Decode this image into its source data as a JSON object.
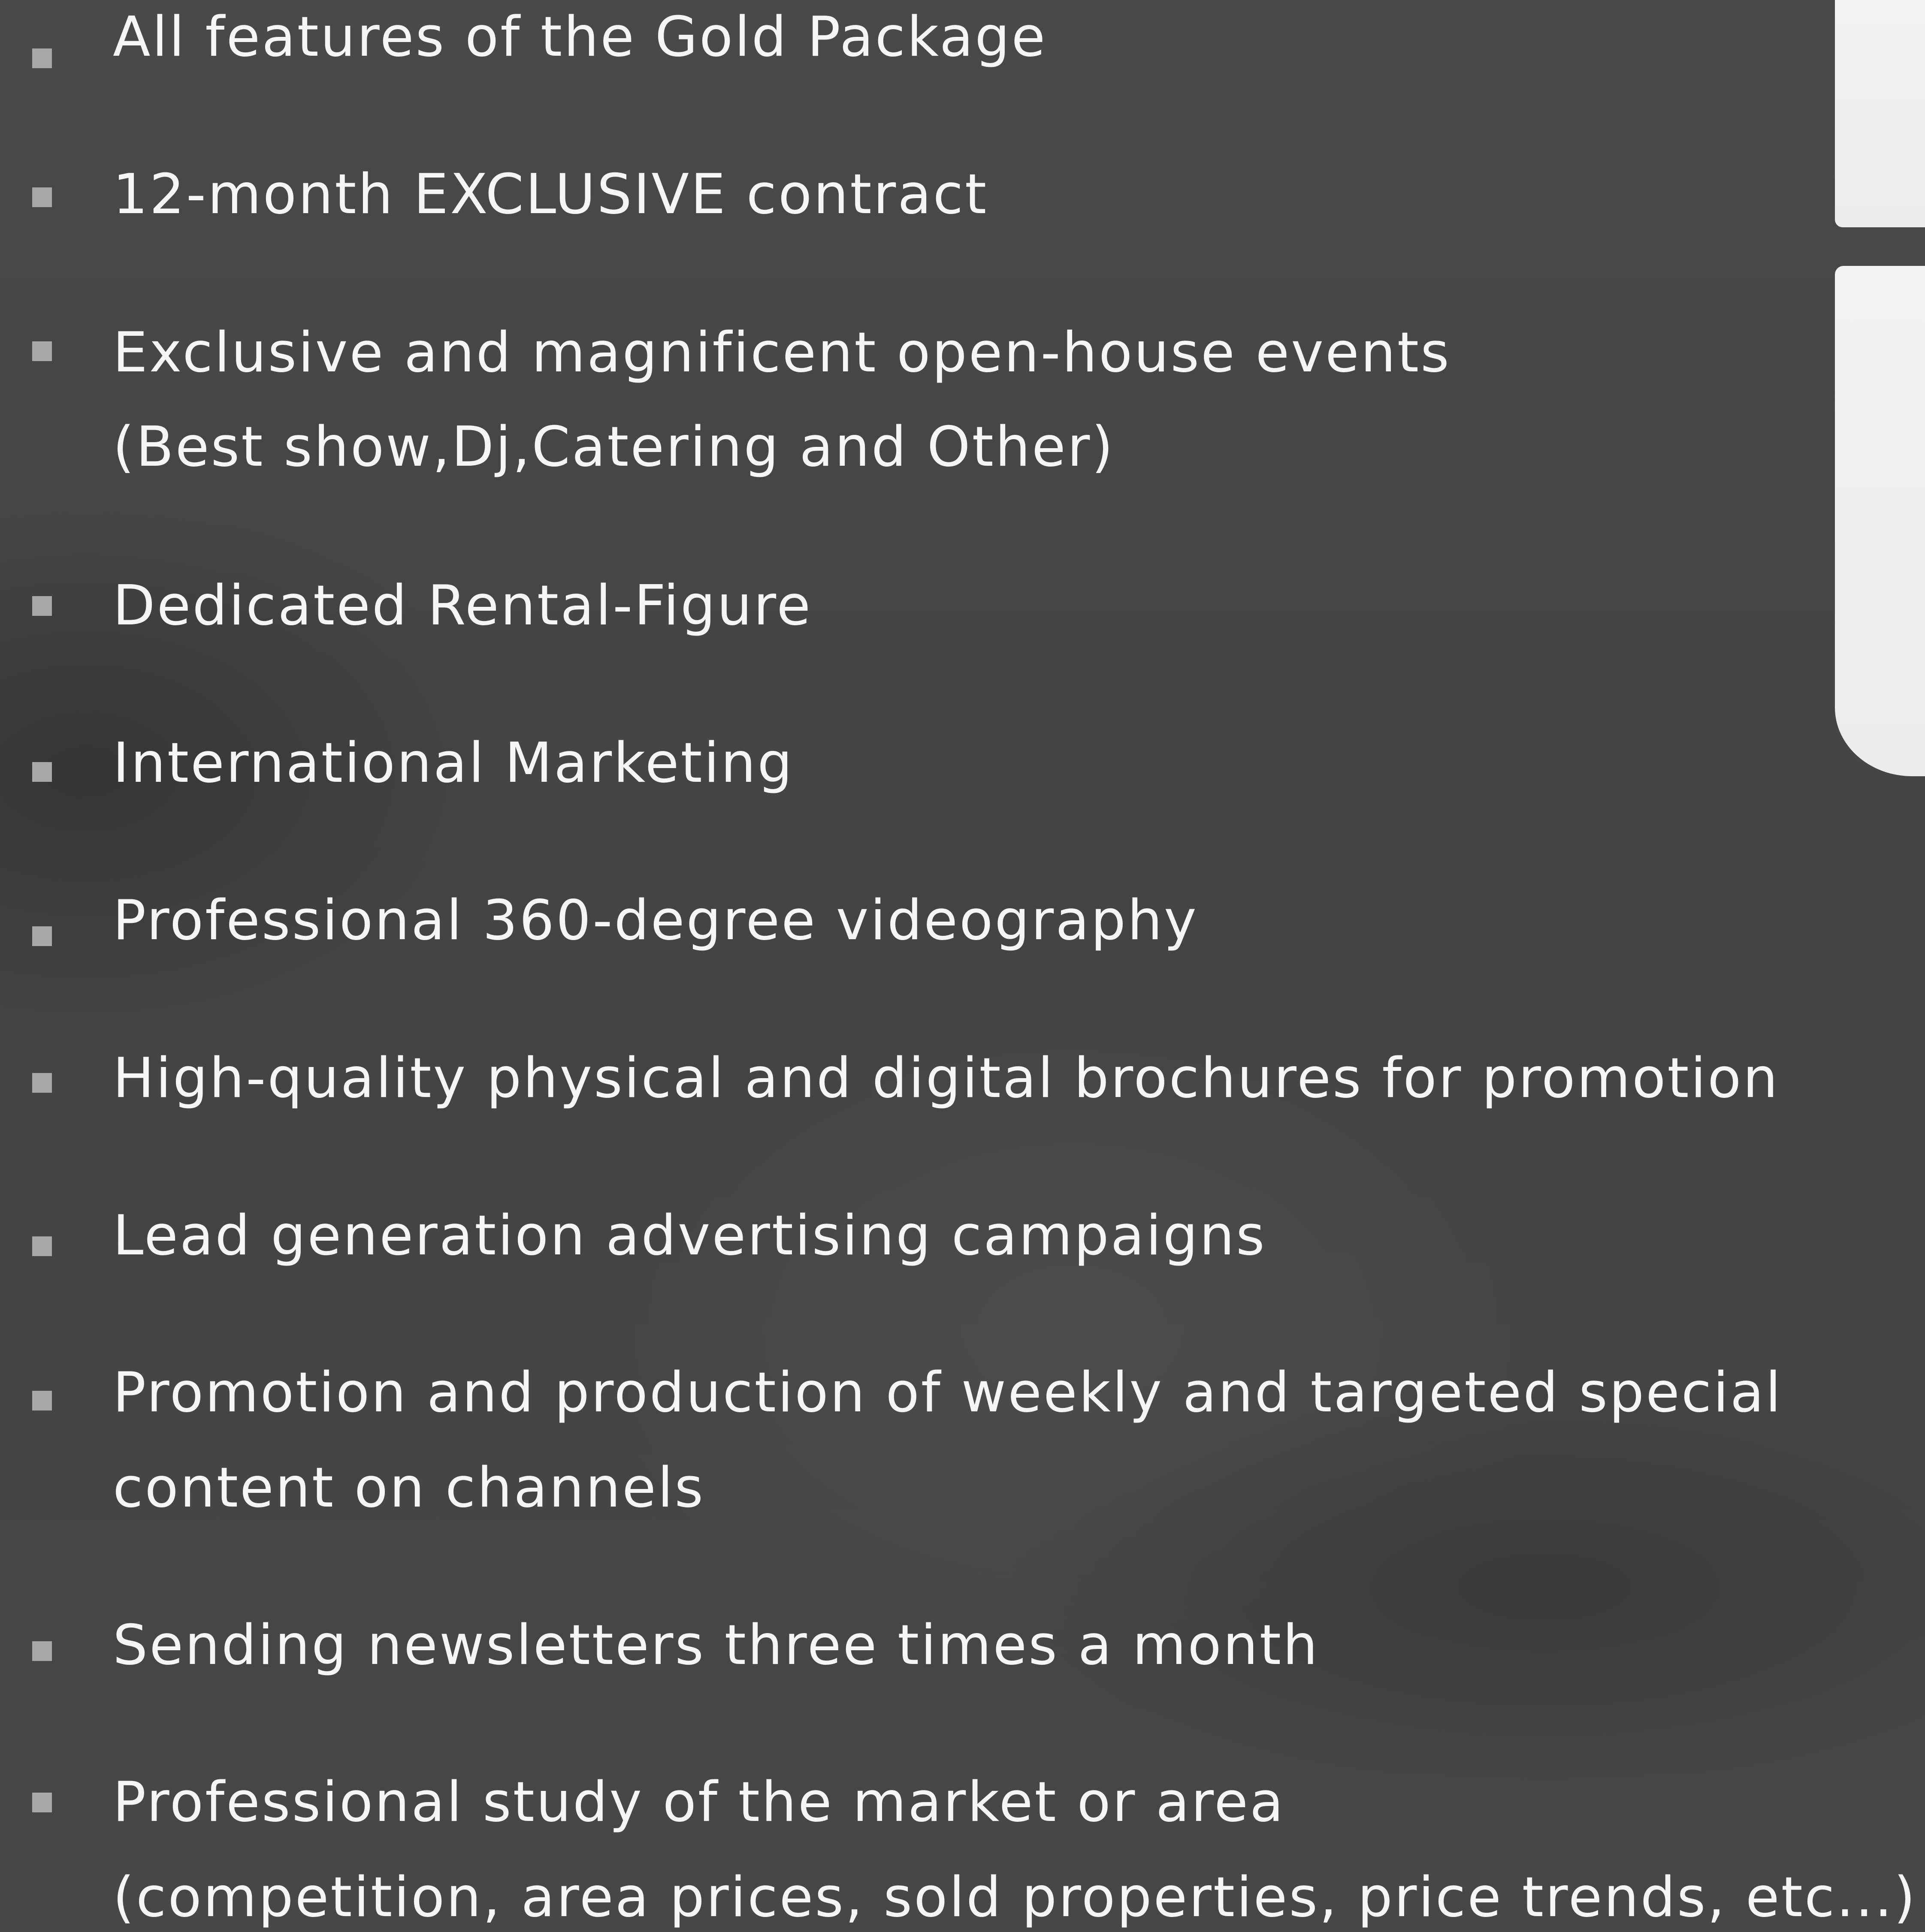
{
  "features": [
    {
      "lines": [
        "All features of the Gold Package"
      ]
    },
    {
      "lines": [
        "12-month EXCLUSIVE contract"
      ]
    },
    {
      "lines": [
        "Exclusive and magnificent open-house events",
        "(Best show,Dj,Catering and Other)"
      ]
    },
    {
      "lines": [
        "Dedicated Rental-Figure"
      ]
    },
    {
      "lines": [
        "International Marketing"
      ]
    },
    {
      "lines": [
        "Professional 360-degree videography"
      ]
    },
    {
      "lines": [
        "High-quality physical and digital brochures for promotion"
      ]
    },
    {
      "lines": [
        "Lead generation advertising campaigns"
      ]
    },
    {
      "lines": [
        "Promotion and production of weekly and targeted special",
        "content on channels"
      ]
    },
    {
      "lines": [
        "Sending newsletters three times a month"
      ]
    },
    {
      "lines": [
        "Professional study of the market or area",
        "(competition, area prices, sold properties, price trends, etc...)"
      ]
    }
  ],
  "colors": {
    "background": "#474646",
    "text": "#f5f5f5",
    "bullet": "#a9a8a8",
    "panel": "#f0f0ef"
  }
}
